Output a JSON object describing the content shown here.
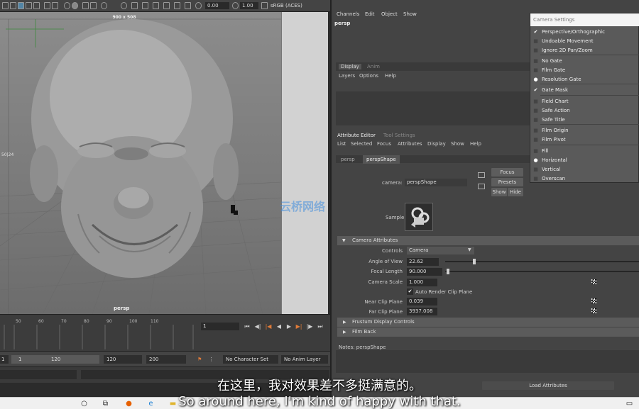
{
  "toolbar": {
    "time_value": "0.00",
    "exposure_value": "1.00",
    "color_space": "sRGB (ACES)"
  },
  "viewport": {
    "resolution_label": "900 x 508",
    "camera_label": "persp",
    "side_label": "50|24"
  },
  "timeline": {
    "ticks": [
      "50",
      "60",
      "70",
      "80",
      "90",
      "100",
      "110"
    ],
    "current_frame": "1"
  },
  "range_bar": {
    "start_frame": "1",
    "range_start": "1",
    "range_end": "120",
    "end_frame": "120",
    "max_frame": "200",
    "character_set": "No Character Set",
    "anim_layer": "No Anim Layer"
  },
  "channel_box": {
    "menus": [
      "Channels",
      "Edit",
      "Object",
      "Show"
    ],
    "object_name": "persp"
  },
  "layer_editor": {
    "tabs": [
      "Display",
      "Anim"
    ],
    "menus": [
      "Layers",
      "Options",
      "Help"
    ]
  },
  "attribute_editor": {
    "tabs": [
      "Attribute Editor",
      "Tool Settings"
    ],
    "menus": [
      "List",
      "Selected",
      "Focus",
      "Attributes",
      "Display",
      "Show",
      "Help"
    ],
    "node_tabs": [
      "persp",
      "perspShape"
    ],
    "node_type_label": "camera:",
    "node_name": "perspShape",
    "buttons": {
      "focus": "Focus",
      "presets": "Presets",
      "show": "Show",
      "hide": "Hide"
    },
    "sample_label": "Sample",
    "camera_attributes": {
      "header": "Camera Attributes",
      "controls_label": "Controls",
      "controls_value": "Camera",
      "angle_of_view_label": "Angle of View",
      "angle_of_view": "22.62",
      "angle_of_view_fraction": 0.14,
      "focal_length_label": "Focal Length",
      "focal_length": "90.000",
      "focal_length_fraction": 0.0,
      "camera_scale_label": "Camera Scale",
      "camera_scale": "1.000",
      "auto_render_clip_label": "Auto Render Clip Plane",
      "auto_render_clip_checked": true,
      "near_clip_label": "Near Clip Plane",
      "near_clip": "0.039",
      "far_clip_label": "Far Clip Plane",
      "far_clip": "3937.008"
    },
    "frustum_header": "Frustum Display Controls",
    "film_back_header": "Film Back",
    "notes_label": "Notes:  perspShape",
    "load_attributes": "Load Attributes"
  },
  "camera_settings_menu": {
    "title": "Camera Settings",
    "items": [
      {
        "label": "Perspective/Orthographic",
        "mark": "check"
      },
      {
        "label": "Undoable Movement",
        "mark": "box"
      },
      {
        "label": "Ignore 2D Pan/Zoom",
        "mark": "box"
      },
      {
        "label": "No Gate",
        "mark": "box"
      },
      {
        "label": "Film Gate",
        "mark": "box"
      },
      {
        "label": "Resolution Gate",
        "mark": "dot"
      },
      {
        "label": "Gate Mask",
        "mark": "check"
      },
      {
        "label": "Field Chart",
        "mark": "box"
      },
      {
        "label": "Safe Action",
        "mark": "box"
      },
      {
        "label": "Safe Title",
        "mark": "box"
      },
      {
        "label": "Film Origin",
        "mark": "box"
      },
      {
        "label": "Film Pivot",
        "mark": "box"
      },
      {
        "label": "Fill",
        "mark": "box"
      },
      {
        "label": "Horizontal",
        "mark": "dot"
      },
      {
        "label": "Vertical",
        "mark": "box"
      },
      {
        "label": "Overscan",
        "mark": "box"
      }
    ]
  },
  "subtitles": {
    "chinese": "在这里，我对效果差不多挺满意的。",
    "english": "So around here, I'm kind of happy with that."
  },
  "watermark": "云桥网络",
  "colors": {
    "accent_blue": "#5285a6",
    "panel": "#444444",
    "viewport": "#7f7f7f"
  }
}
